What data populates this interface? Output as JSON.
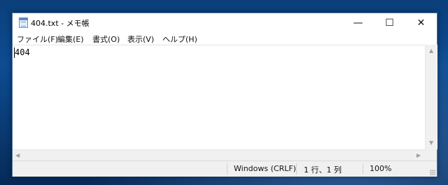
{
  "window": {
    "title": "404.txt - メモ帳",
    "controls": {
      "minimize": "—",
      "maximize": "☐",
      "close": "✕"
    }
  },
  "menu": {
    "items": [
      {
        "label": "ファイル(F)"
      },
      {
        "label": "編集(E)"
      },
      {
        "label": "書式(O)"
      },
      {
        "label": "表示(V)"
      },
      {
        "label": "ヘルプ(H)"
      }
    ]
  },
  "editor": {
    "content": "404"
  },
  "scrollbars": {
    "up": "▲",
    "down": "▼",
    "left": "◀",
    "right": "▶"
  },
  "status": {
    "encoding": "Windows (CRLF)",
    "position": "1 行、1 列",
    "zoom": "100%"
  },
  "icons": {
    "app": "notepad-icon",
    "grip": "resize-grip-icon"
  }
}
